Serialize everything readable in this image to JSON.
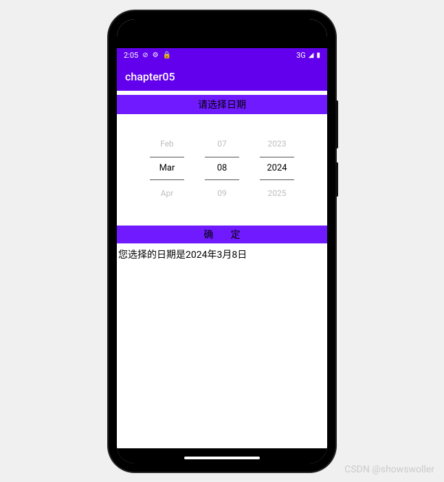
{
  "statusbar": {
    "time": "2:05",
    "network": "3G"
  },
  "appbar": {
    "title": "chapter05"
  },
  "header": {
    "label": "请选择日期"
  },
  "picker": {
    "month": {
      "prev": "Feb",
      "sel": "Mar",
      "next": "Apr"
    },
    "day": {
      "prev": "07",
      "sel": "08",
      "next": "09"
    },
    "year": {
      "prev": "2023",
      "sel": "2024",
      "next": "2025"
    }
  },
  "confirm": {
    "label": "确定"
  },
  "result": {
    "text": "您选择的日期是2024年3月8日"
  },
  "watermark": "CSDN @showswoller"
}
